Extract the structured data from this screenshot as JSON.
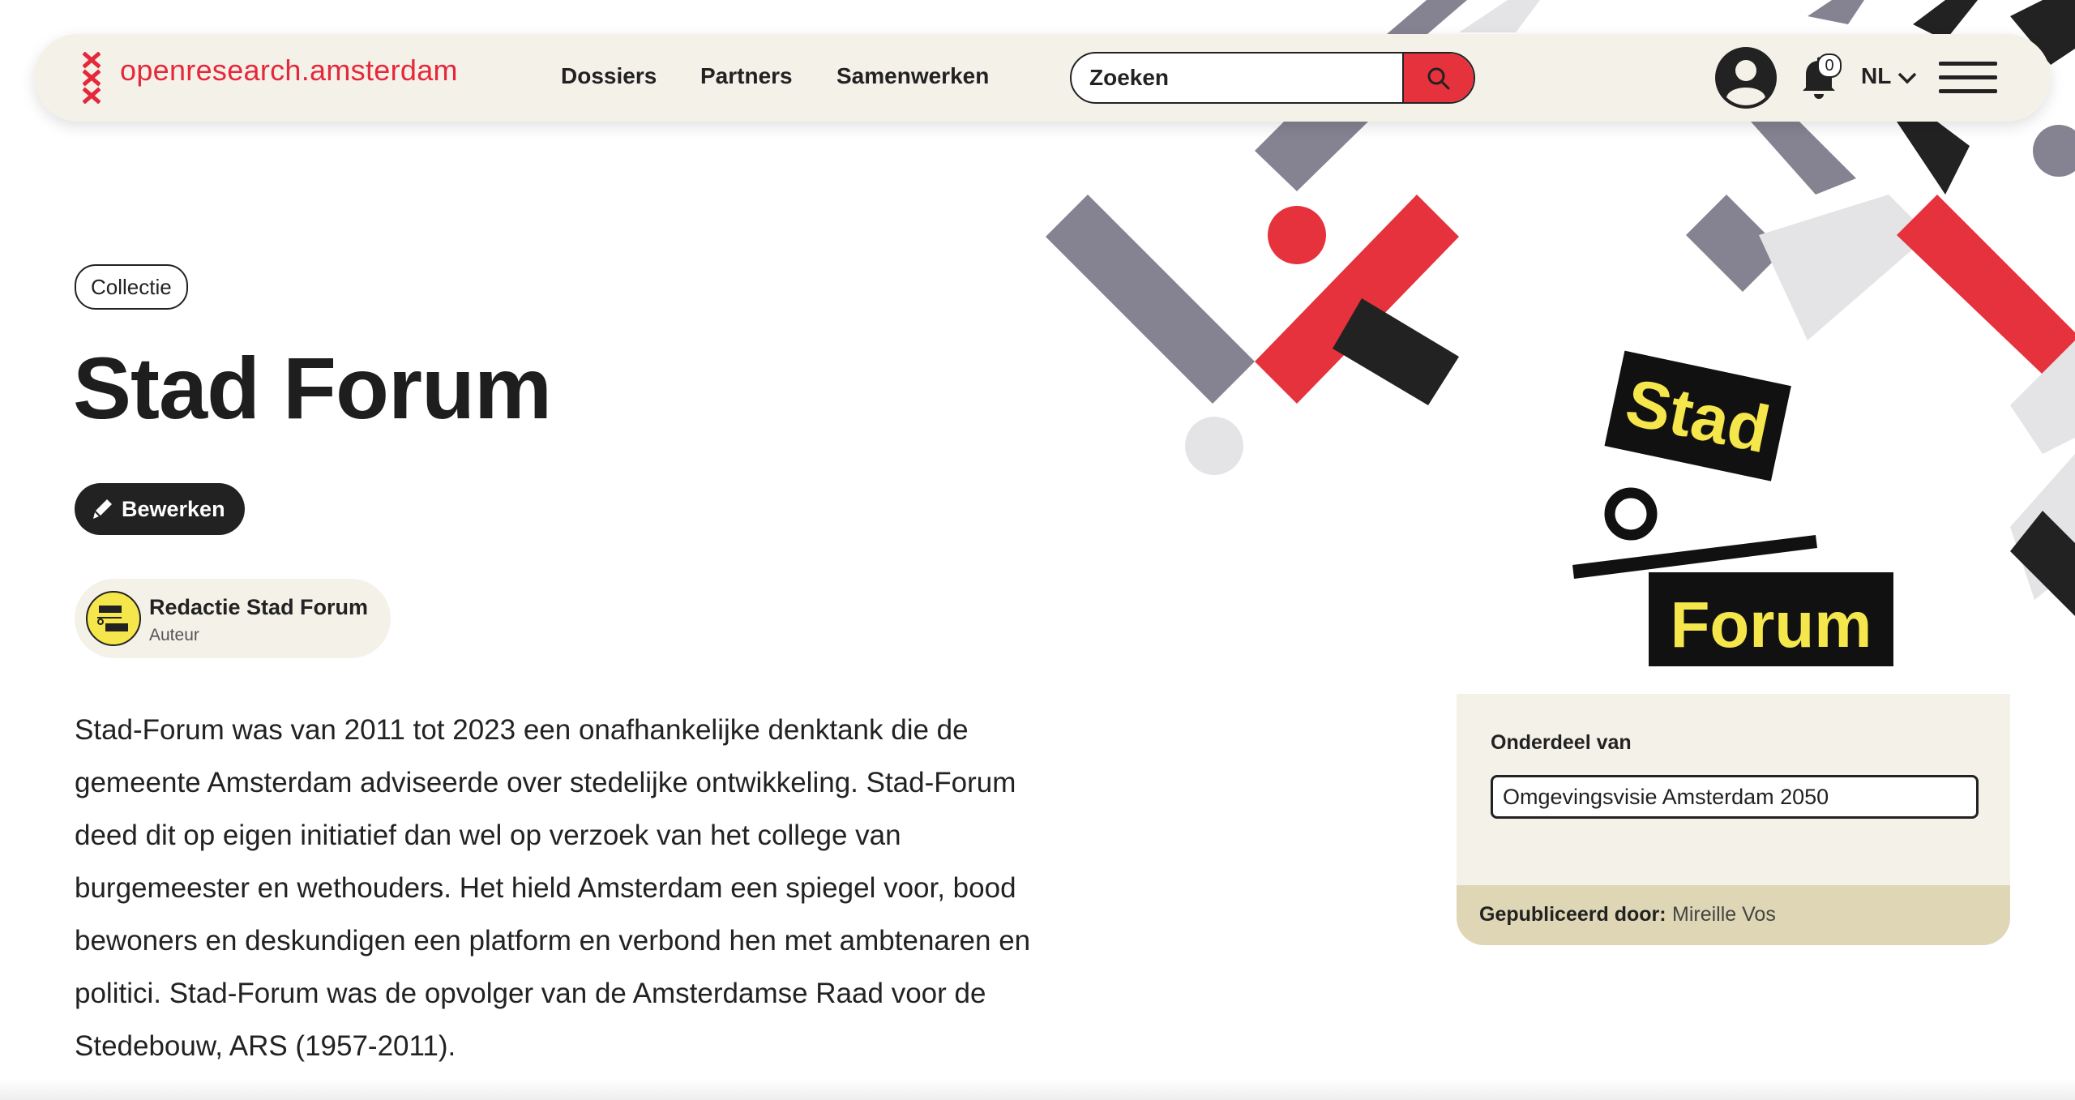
{
  "header": {
    "site_name": "openresearch.amsterdam",
    "nav": [
      {
        "label": "Dossiers"
      },
      {
        "label": "Partners"
      },
      {
        "label": "Samenwerken"
      }
    ],
    "search": {
      "placeholder": "Zoeken"
    },
    "notification_count": "0",
    "language": "NL",
    "icons": [
      "amsterdam-crosses-logo-icon",
      "search-icon",
      "user-avatar-icon",
      "bell-icon",
      "chevron-down-icon",
      "hamburger-menu-icon"
    ]
  },
  "main": {
    "tag": "Collectie",
    "title": "Stad Forum",
    "edit_label": "Bewerken",
    "author": {
      "name": "Redactie Stad Forum",
      "role": "Auteur"
    },
    "description": "Stad-Forum was van 2011 tot 2023 een onafhankelijke denktank die de gemeente Amsterdam adviseerde over stedelijke ontwikkeling. Stad-Forum deed dit op eigen initiatief dan wel op verzoek van het college van burgemeester en wethouders. Het hield Amsterdam een spiegel voor, bood bewoners en deskundigen een platform en verbond hen met ambtenaren en politici. Stad-Forum was de opvolger van de Amsterdamse Raad voor de Stedebouw, ARS (1957-2011)."
  },
  "sidebar": {
    "logo_words": [
      "Stad",
      "Forum"
    ],
    "part_of_label": "Onderdeel van",
    "part_of_link": "Omgevingsvisie Amsterdam 2050",
    "published_by_label": "Gepubliceerd door:",
    "published_by_name": "Mireille Vos"
  },
  "colors": {
    "accent_red": "#e5323c",
    "dark": "#222222",
    "grey": "#858391",
    "light_grey": "#e4e4e6",
    "cream": "#f4f1e9",
    "sand": "#ded6b4",
    "logo_yellow": "#f5e64b"
  }
}
